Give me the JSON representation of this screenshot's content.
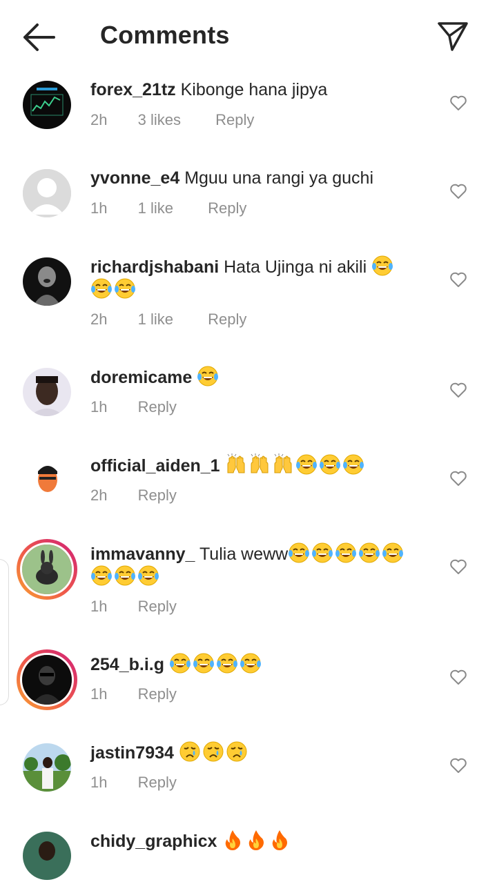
{
  "header": {
    "title": "Comments"
  },
  "comments": [
    {
      "username": "forex_21tz",
      "text": "Kibonge hana jipya",
      "time": "2h",
      "likes": "3 likes",
      "reply": "Reply"
    },
    {
      "username": "yvonne_e4",
      "text": "Mguu una rangi ya guchi",
      "time": "1h",
      "likes": "1 like",
      "reply": "Reply"
    },
    {
      "username": "richardjshabani",
      "text": "Hata Ujinga ni akili",
      "time": "2h",
      "likes": "1 like",
      "reply": "Reply"
    },
    {
      "username": "doremicame",
      "text": "",
      "time": "1h",
      "reply": "Reply"
    },
    {
      "username": "official_aiden_1",
      "text": "",
      "time": "2h",
      "reply": "Reply"
    },
    {
      "username": "immavanny_",
      "text": "Tulia weww",
      "time": "1h",
      "reply": "Reply"
    },
    {
      "username": "254_b.i.g",
      "text": "",
      "time": "1h",
      "reply": "Reply"
    },
    {
      "username": "jastin7934",
      "text": "",
      "time": "1h",
      "reply": "Reply"
    },
    {
      "username": "chidy_graphicx",
      "text": ""
    }
  ],
  "icon_names": [
    "back-arrow-icon",
    "send-icon",
    "heart-icon",
    "laughing-crying-emoji",
    "raised-hands-emoji",
    "crying-emoji",
    "fire-emoji"
  ],
  "colors": {
    "text": "#262626",
    "meta": "#8e8e8e",
    "story_ring_start": "#f9a331",
    "story_ring_end": "#d01f77"
  }
}
